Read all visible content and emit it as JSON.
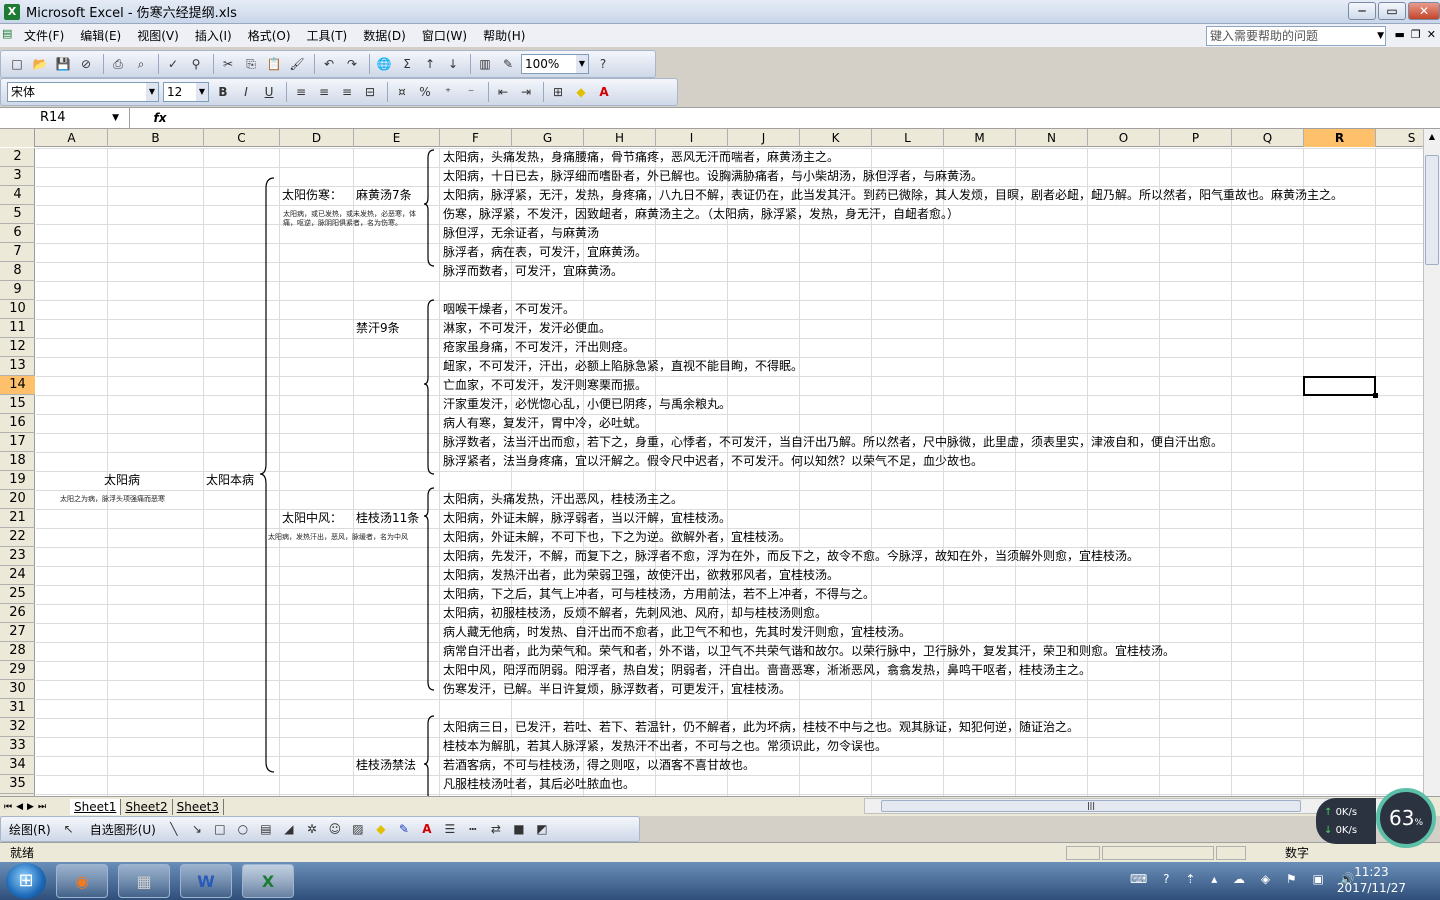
{
  "window": {
    "title": "Microsoft Excel - 伤寒六经提纲.xls",
    "min": "─",
    "max": "▭",
    "close": "✕"
  },
  "menu": {
    "items": [
      "文件(F)",
      "编辑(E)",
      "视图(V)",
      "插入(I)",
      "格式(O)",
      "工具(T)",
      "数据(D)",
      "窗口(W)",
      "帮助(H)"
    ],
    "help_placeholder": "键入需要帮助的问题"
  },
  "toolbar": {
    "zoom": "100%",
    "font": "宋体",
    "size": "12",
    "bold": "B",
    "italic": "I",
    "underline": "U",
    "percent": "%",
    "sigma": "Σ"
  },
  "formula": {
    "name_box": "R14",
    "fx": "fx",
    "content": ""
  },
  "grid": {
    "columns": [
      "A",
      "B",
      "C",
      "D",
      "E",
      "F",
      "G",
      "H",
      "I",
      "J",
      "K",
      "L",
      "M",
      "N",
      "O",
      "P",
      "Q",
      "R",
      "S"
    ],
    "rows": [
      "2",
      "3",
      "4",
      "5",
      "6",
      "7",
      "8",
      "9",
      "10",
      "11",
      "12",
      "13",
      "14",
      "15",
      "16",
      "17",
      "18",
      "19",
      "20",
      "21",
      "22",
      "23",
      "24",
      "25",
      "26",
      "27",
      "28",
      "29",
      "30",
      "31",
      "32",
      "33",
      "34",
      "35"
    ],
    "selected_col": "R",
    "selected_row": "14",
    "b19": "太阳病",
    "a20_note": "太阳之为病，脉浮头项强痛而恶寒",
    "c19": "太阳本病",
    "d4": "太阳伤寒：",
    "d5_note1": "太阳病，或已发热，或未发热，必恶寒，体",
    "d5_note2": "痛，呕逆，脉阴阳俱紧者，名为伤寒。",
    "e4": "麻黄汤7条",
    "e11": "禁汗9条",
    "d21": "太阳中风：",
    "d22_note": "太阳病，发热汗出，恶风，脉缓者，名为中风",
    "e21": "桂枝汤11条",
    "e34": "桂枝汤禁法",
    "f_lines": [
      "太阳病，头痛发热，身痛腰痛，骨节痛疼，恶风无汗而喘者，麻黄汤主之。",
      "太阳病，十日已去，脉浮细而嗜卧者，外已解也。设胸满胁痛者，与小柴胡汤，脉但浮者，与麻黄汤。",
      "太阳病，脉浮紧，无汗，发热，身疼痛，八九日不解，表证仍在，此当发其汗。到药已微除，其人发烦，目瞑，剧者必衄，衄乃解。所以然者，阳气重故也。麻黄汤主之。",
      "伤寒，脉浮紧，不发汗，因致衄者，麻黄汤主之。（太阳病，脉浮紧，发热，身无汗，自衄者愈。）",
      "脉但浮，无余证者，与麻黄汤",
      "脉浮者，病在表，可发汗，宜麻黄汤。",
      "脉浮而数者，可发汗，宜麻黄汤。",
      "",
      "咽喉干燥者，不可发汗。",
      "淋家，不可发汗，发汗必便血。",
      "疮家虽身痛，不可发汗，汗出则痉。",
      "衄家，不可发汗，汗出，必额上陷脉急紧，直视不能目眴，不得眠。",
      "亡血家，不可发汗，发汗则寒栗而振。",
      "汗家重发汗，必恍惚心乱，小便已阴疼，与禹余粮丸。",
      "病人有寒，复发汗，胃中冷，必吐蚘。",
      "脉浮数者，法当汗出而愈，若下之，身重，心悸者，不可发汗，当自汗出乃解。所以然者，尺中脉微，此里虚，须表里实，津液自和，便自汗出愈。",
      "脉浮紧者，法当身疼痛，宜以汗解之。假令尺中迟者，不可发汗。何以知然？以荣气不足，血少故也。",
      "",
      "太阳病，头痛发热，汗出恶风，桂枝汤主之。",
      "太阳病，外证未解，脉浮弱者，当以汗解，宜桂枝汤。",
      "太阳病，外证未解，不可下也，下之为逆。欲解外者，宜桂枝汤。",
      "太阳病，先发汗，不解，而复下之，脉浮者不愈，浮为在外，而反下之，故令不愈。今脉浮，故知在外，当须解外则愈，宜桂枝汤。",
      "太阳病，发热汗出者，此为荣弱卫强，故使汗出，欲救邪风者，宜桂枝汤。",
      "太阳病，下之后，其气上冲者，可与桂枝汤，方用前法，若不上冲者，不得与之。",
      "太阳病，初服桂枝汤，反烦不解者，先刺风池、风府，却与桂枝汤则愈。",
      "病人藏无他病，时发热、自汗出而不愈者，此卫气不和也，先其时发汗则愈，宜桂枝汤。",
      "病常自汗出者，此为荣气和。荣气和者，外不谐，以卫气不共荣气谐和故尔。以荣行脉中，卫行脉外，复发其汗，荣卫和则愈。宜桂枝汤。",
      "太阳中风，阳浮而阴弱。阳浮者，热自发；阴弱者，汗自出。啬啬恶寒，淅淅恶风，翕翕发热，鼻鸣干呕者，桂枝汤主之。",
      "伤寒发汗，已解。半日许复烦，脉浮数者，可更发汗，宜桂枝汤。",
      "",
      "太阳病三日，已发汗，若吐、若下、若温针，仍不解者，此为坏病，桂枝不中与之也。观其脉证，知犯何逆，随证治之。",
      "桂枝本为解肌，若其人脉浮紧，发热汗不出者，不可与之也。常须识此，勿令误也。",
      "若酒客病，不可与桂枝汤，得之则呕，以酒客不喜甘故也。",
      "凡服桂枝汤吐者，其后必吐脓血也。"
    ]
  },
  "sheets": [
    "Sheet1",
    "Sheet2",
    "Sheet3"
  ],
  "drawbar": {
    "draw": "绘图(R)",
    "autoshape": "自选图形(U)"
  },
  "status": {
    "ready": "就绪",
    "num": "数字"
  },
  "net": {
    "up": "0K/s",
    "down": "0K/s",
    "percent": "63",
    "percent_unit": "%"
  },
  "clock": {
    "time": "11:23",
    "date": "2017/11/27"
  }
}
